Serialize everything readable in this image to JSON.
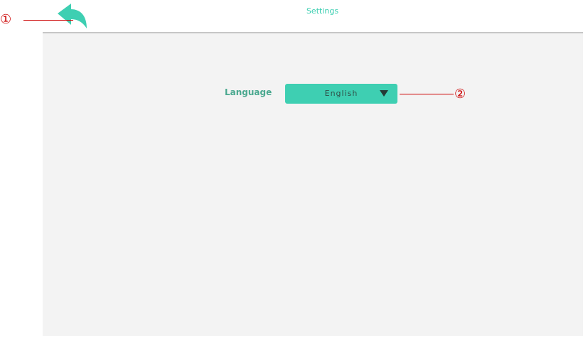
{
  "header": {
    "title": "Settings",
    "back_icon": "back-arrow-icon"
  },
  "settings": {
    "language_label": "Language",
    "language_value": "English",
    "dropdown_icon": "triangle-down-icon"
  },
  "annotations": {
    "marker_1": "①",
    "marker_2": "②"
  },
  "colors": {
    "accent": "#3ecfb2",
    "label_text": "#4aa88f",
    "panel_background": "#f3f3f3",
    "callout": "#cc0000"
  }
}
